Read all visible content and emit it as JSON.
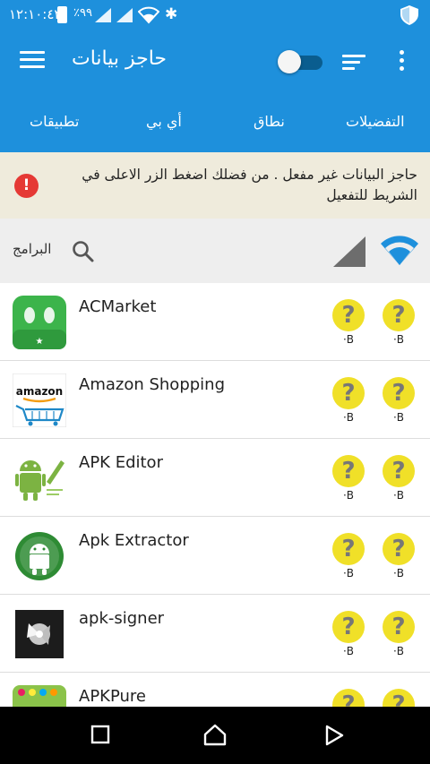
{
  "status_bar": {
    "time": "١٢:١٠:٤٢",
    "battery": "٪٩٩"
  },
  "app_bar": {
    "title": "حاجز بيانات",
    "toggle_on": false
  },
  "tabs": [
    {
      "label": "التفضيلات"
    },
    {
      "label": "نطاق"
    },
    {
      "label": "أي بي"
    },
    {
      "label": "تطبيقات"
    }
  ],
  "warning": {
    "text": "حاجز البيانات غير مفعل . من فضلك اضغط الزر الاعلى في الشريط للتفعيل"
  },
  "filter": {
    "programs_label": "البرامج"
  },
  "apps": [
    {
      "name": "ACMarket",
      "wifi_value": "·B",
      "cell_value": "·B"
    },
    {
      "name": "Amazon Shopping",
      "wifi_value": "·B",
      "cell_value": "·B"
    },
    {
      "name": "APK Editor",
      "wifi_value": "·B",
      "cell_value": "·B"
    },
    {
      "name": "Apk Extractor",
      "wifi_value": "·B",
      "cell_value": "·B"
    },
    {
      "name": "apk-signer",
      "wifi_value": "·B",
      "cell_value": "·B"
    },
    {
      "name": "APKPure",
      "wifi_value": "",
      "cell_value": ""
    }
  ],
  "icons": {
    "amazon_logo_text": "amazon"
  },
  "colors": {
    "primary": "#1e90dc",
    "warning_bg": "#efebdc",
    "alert": "#e53935",
    "unknown_badge": "#f0e028"
  }
}
